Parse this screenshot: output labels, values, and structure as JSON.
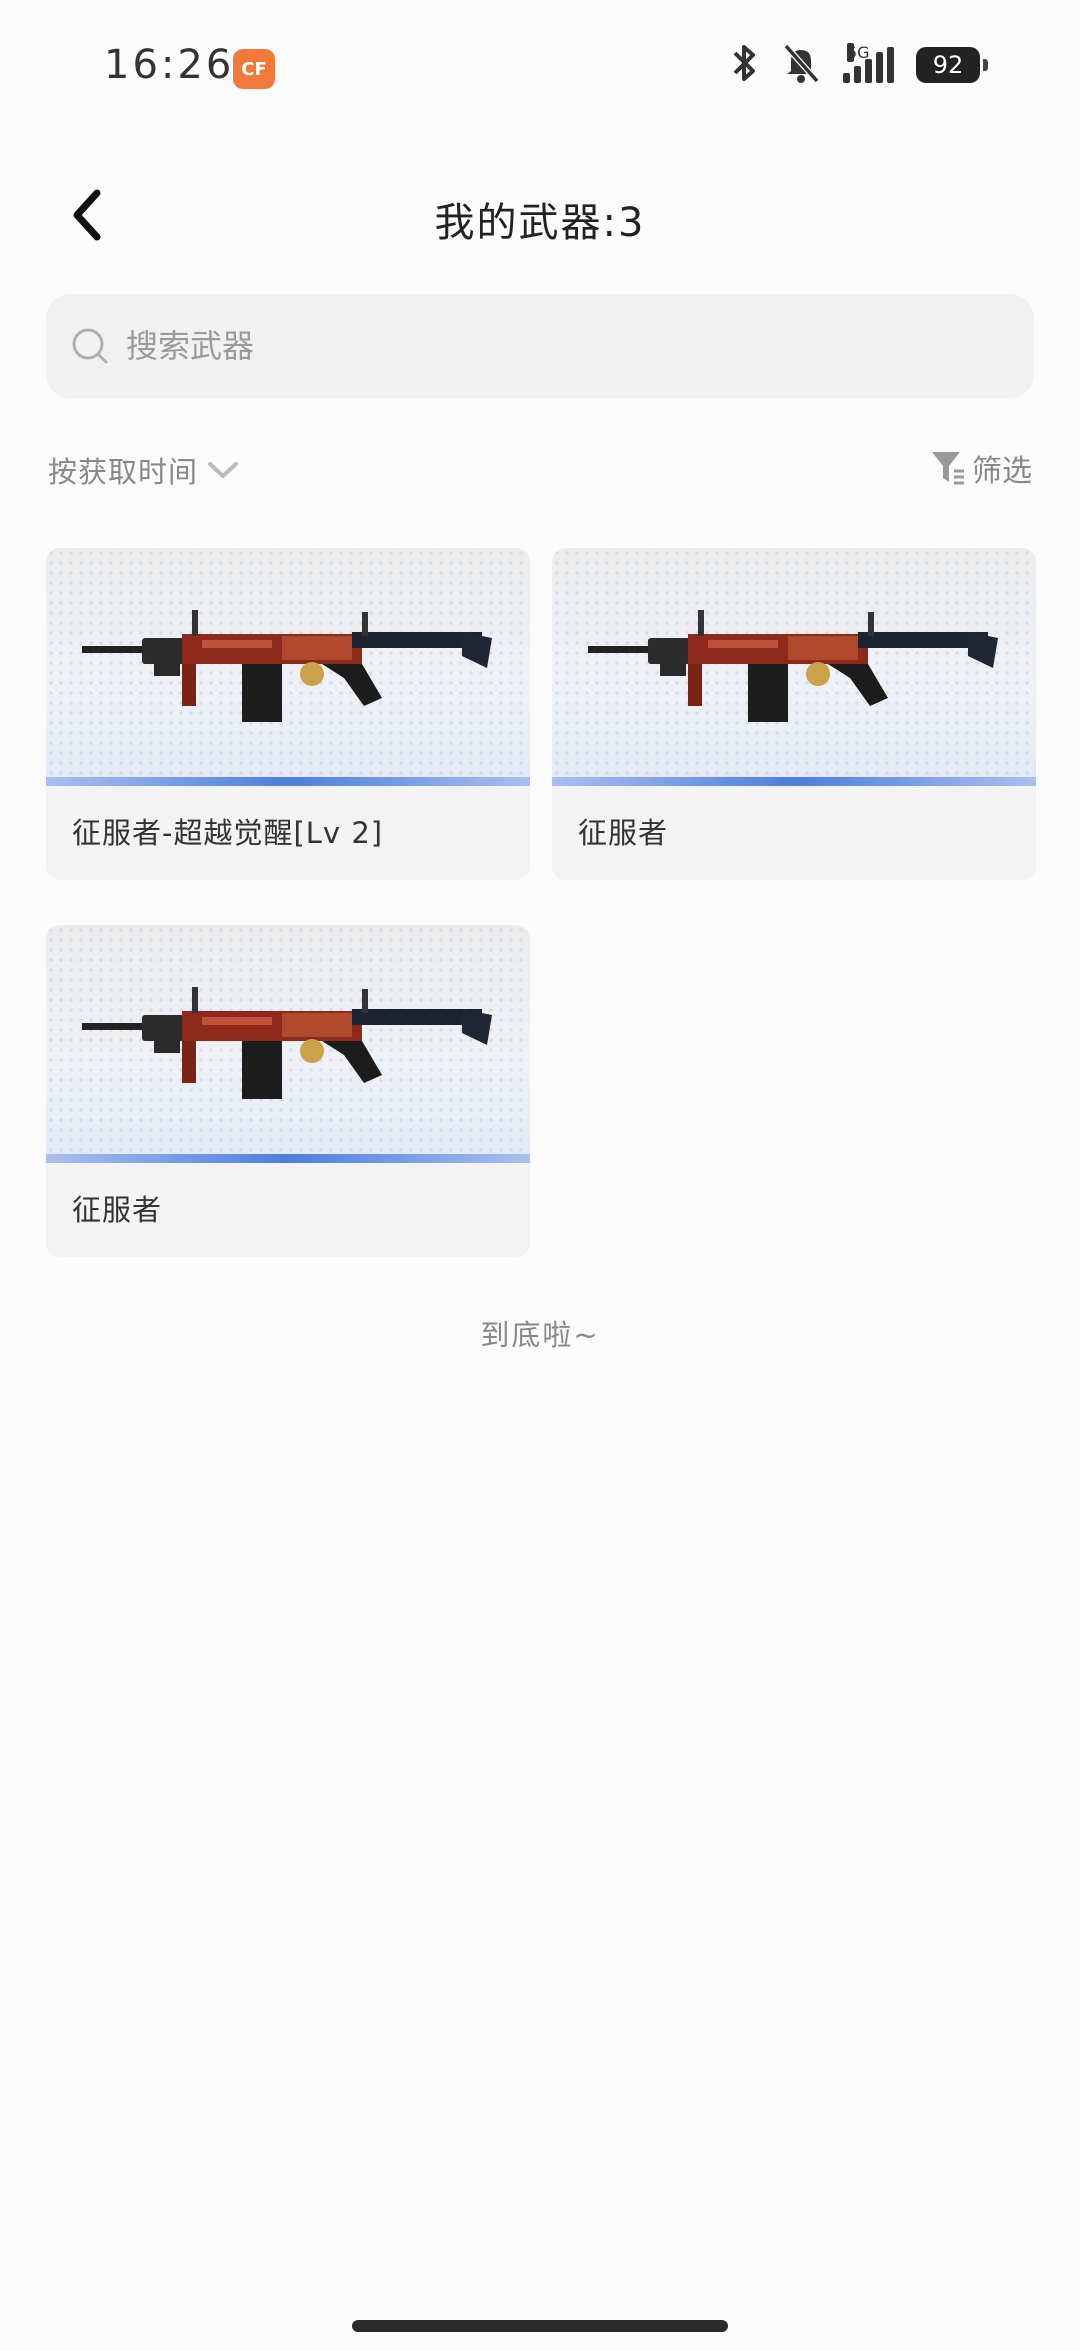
{
  "status_bar": {
    "time": "16:26",
    "app_badge": "CF",
    "network": "5G",
    "battery": "92",
    "icons": [
      "bluetooth-icon",
      "bell-muted-icon",
      "signal-icon",
      "battery-icon"
    ]
  },
  "header": {
    "title": "我的武器:3"
  },
  "search": {
    "placeholder": "搜索武器",
    "value": ""
  },
  "toolbar": {
    "sort_label": "按获取时间",
    "filter_label": "筛选"
  },
  "weapons": [
    {
      "name": "征服者-超越觉醒[Lv 2]"
    },
    {
      "name": "征服者"
    },
    {
      "name": "征服者"
    }
  ],
  "list_end_text": "到底啦~",
  "colors": {
    "rarity_bar": "#4e7ddc",
    "weapon_body": "#9a2a1c",
    "app_badge": "#f07a3a"
  }
}
